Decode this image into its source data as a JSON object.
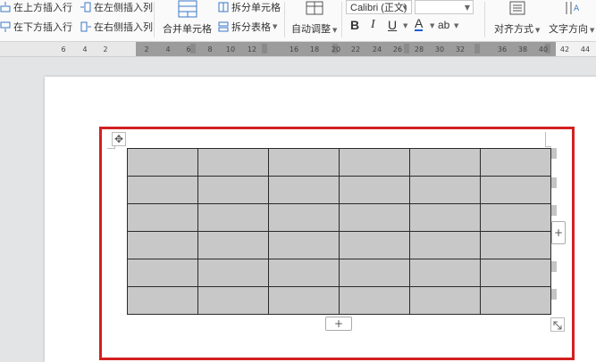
{
  "ribbon": {
    "insert_above": "在上方插入行",
    "insert_below": "在下方插入行",
    "insert_left": "在左侧插入列",
    "insert_right": "在右侧插入列",
    "merge_cells": "合并单元格",
    "split_cells": "拆分单元格",
    "split_table": "拆分表格",
    "auto_fit": "自动调整",
    "font_name": "Calibri (正文)",
    "bold": "B",
    "italic": "I",
    "underline": "U",
    "font_color": "A",
    "highlight": "ab",
    "align": "对齐方式",
    "text_direction": "文字方向"
  },
  "ruler": {
    "ticks": [
      "6",
      "4",
      "2",
      "2",
      "4",
      "6",
      "8",
      "10",
      "12",
      "16",
      "18",
      "20",
      "22",
      "24",
      "26",
      "28",
      "30",
      "32",
      "36",
      "38",
      "40",
      "42",
      "44"
    ]
  },
  "table": {
    "rows": 6,
    "cols": 6,
    "cell_color": "#c8c8c8"
  },
  "highlight_color": "#d32020",
  "page": {
    "add_row_label": "+",
    "add_col_label": "+"
  }
}
